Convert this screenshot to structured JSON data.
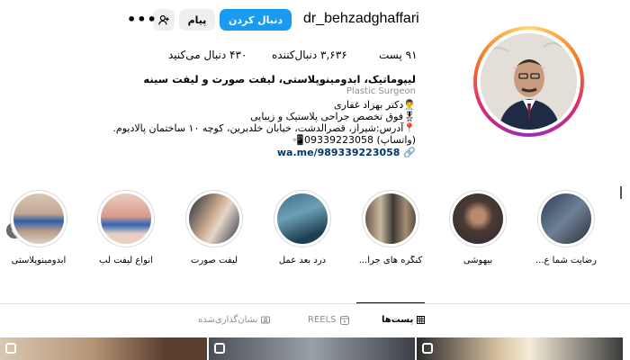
{
  "header": {
    "username": "dr_behzadghaffari",
    "follow_label": "دنبال کردن",
    "message_label": "پیام",
    "add_user_icon": "add-user-icon",
    "more_label": "•••"
  },
  "stats": {
    "posts": "۹۱ پست",
    "followers": "۳,۶۳۶ دنبال‌کننده",
    "following": "۴۳۰ دنبال می‌کنید"
  },
  "bio": {
    "name": "لیپوماتیک، ابدومینوپلاستی، لیفت صورت و لیفت سینه",
    "category": "Plastic Surgeon",
    "line1": "👨‍⚕️دکتر بهزاد غفاری",
    "line2": "🎖فوق تخصص جراحی پلاستیک و زیبایی",
    "line3": "📍آدرس:شیراز، قصرالدشت، خیابان خلدبرین، کوچه ۱۰ ساختمان پالادیوم.",
    "line4": "📲09339223058 (واتساپ)",
    "link": "wa.me/989339223058"
  },
  "highlights": [
    {
      "label": "رضایت شما ع..."
    },
    {
      "label": "بیهوشی"
    },
    {
      "label": "کنگره های جرا..."
    },
    {
      "label": "درد بعد عمل"
    },
    {
      "label": "لیفت صورت"
    },
    {
      "label": "انواع لیفت لب"
    },
    {
      "label": "ابدومینوپلاستی"
    }
  ],
  "tabs": {
    "posts": "پست‌ها",
    "reels": "REELS",
    "tagged": "نشان‌گذاری‌شده"
  },
  "colors": {
    "follow": "#1a9bf0",
    "link": "#00376b"
  }
}
